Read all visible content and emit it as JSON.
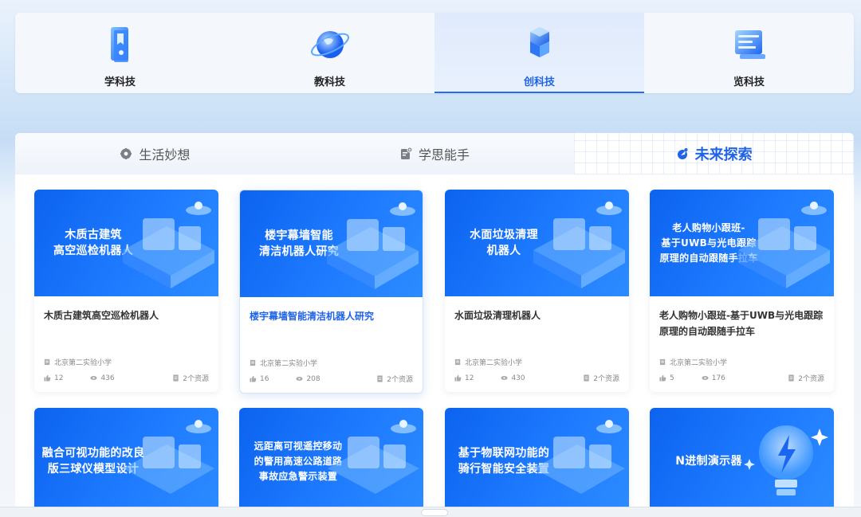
{
  "colors": {
    "accent": "#1f63e6",
    "banner": "#1470fa",
    "muted": "#888888"
  },
  "topnav": {
    "items": [
      {
        "label": "学科技",
        "icon": "book-icon",
        "active": false
      },
      {
        "label": "教科技",
        "icon": "globe-icon",
        "active": false
      },
      {
        "label": "创科技",
        "icon": "cubes-icon",
        "active": true
      },
      {
        "label": "览科技",
        "icon": "window-icon",
        "active": false
      }
    ]
  },
  "subtabs": [
    {
      "label": "生活妙想",
      "icon": "gear-icon",
      "active": false
    },
    {
      "label": "学思能手",
      "icon": "document-plus-icon",
      "active": false
    },
    {
      "label": "未来探索",
      "icon": "rocket-icon",
      "active": true
    }
  ],
  "cards": [
    {
      "banner": "木质古建筑\n高空巡检机器人",
      "title": "木质古建筑高空巡检机器人",
      "school": "北京第二实验小学",
      "likes": "12",
      "views": "436",
      "resources": "2个资源"
    },
    {
      "banner": "楼宇幕墙智能\n清洁机器人研究",
      "title": "楼宇幕墙智能清洁机器人研究",
      "school": "北京第二实验小学",
      "likes": "16",
      "views": "208",
      "resources": "2个资源"
    },
    {
      "banner": "水面垃圾清理\n机器人",
      "title": "水面垃圾清理机器人",
      "school": "北京第二实验小学",
      "likes": "12",
      "views": "430",
      "resources": "2个资源"
    },
    {
      "banner": "老人购物小跟班-\n基于UWB与光电跟踪\n原理的自动跟随手拉车",
      "title": "老人购物小跟班-基于UWB与光电跟踪原理的自动跟随手拉车",
      "school": "北京第二实验小学",
      "likes": "5",
      "views": "176",
      "resources": "2个资源"
    },
    {
      "banner": "融合可视功能的改良\n版三球仪模型设计"
    },
    {
      "banner": "远距离可视遥控移动\n的警用高速公路道路\n事故应急警示装置"
    },
    {
      "banner": "基于物联网功能的\n骑行智能安全装置"
    },
    {
      "banner": "N进制演示器"
    }
  ]
}
